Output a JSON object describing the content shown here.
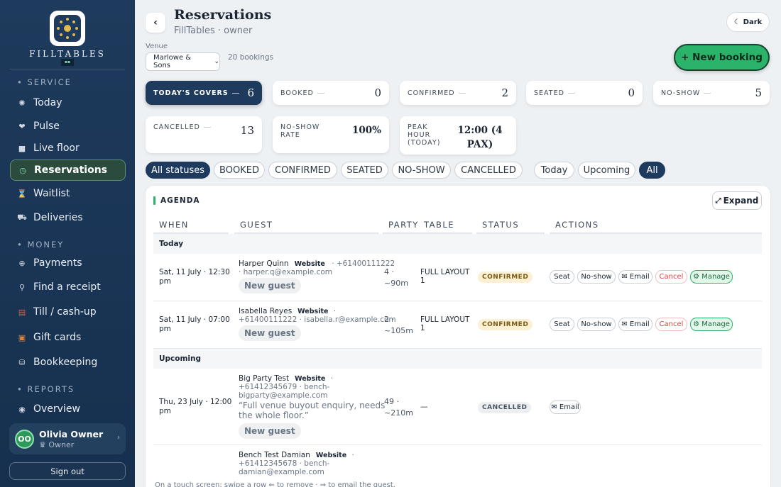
{
  "sidebar": {
    "brand": "FILLTABLES",
    "sections": {
      "service": "SERVICE",
      "money": "MONEY",
      "reports": "REPORTS"
    },
    "items": [
      {
        "label": "Today",
        "icon": "sun-icon"
      },
      {
        "label": "Pulse",
        "icon": "heart-icon"
      },
      {
        "label": "Live floor",
        "icon": "floor-icon"
      },
      {
        "label": "Reservations",
        "icon": "clock-icon"
      },
      {
        "label": "Waitlist",
        "icon": "hourglass-icon"
      },
      {
        "label": "Deliveries",
        "icon": "truck-icon"
      },
      {
        "label": "Payments",
        "icon": "circle-plus-icon"
      },
      {
        "label": "Find a receipt",
        "icon": "search-icon"
      },
      {
        "label": "Till / cash-up",
        "icon": "till-icon"
      },
      {
        "label": "Gift cards",
        "icon": "gift-icon"
      },
      {
        "label": "Bookkeeping",
        "icon": "database-icon"
      },
      {
        "label": "Overview",
        "icon": "radio-icon"
      }
    ],
    "user": {
      "initials": "OO",
      "name": "Olivia Owner",
      "role": "Owner"
    },
    "signout": "Sign out"
  },
  "header": {
    "title": "Reservations",
    "subtitle": "FillTables · owner",
    "dark_label": "Dark",
    "venue_label": "Venue",
    "venue": "Marlowe & Sons",
    "bookings_count": "20 bookings",
    "new_booking": "+ New booking"
  },
  "stats": [
    {
      "label": "TODAY'S COVERS",
      "value": "6"
    },
    {
      "label": "BOOKED",
      "value": "0"
    },
    {
      "label": "CONFIRMED",
      "value": "2"
    },
    {
      "label": "SEATED",
      "value": "0"
    },
    {
      "label": "NO-SHOW",
      "value": "5"
    },
    {
      "label": "CANCELLED",
      "value": "13"
    },
    {
      "label": "NO-SHOW RATE",
      "value": "100%"
    },
    {
      "label": "PEAK HOUR (TODAY)",
      "value": "12:00 (4 PAX)"
    }
  ],
  "filters": {
    "statuses": [
      "All statuses",
      "BOOKED",
      "CONFIRMED",
      "SEATED",
      "NO-SHOW",
      "CANCELLED"
    ],
    "ranges": [
      "Today",
      "Upcoming",
      "All"
    ]
  },
  "agenda": {
    "title": "AGENDA",
    "expand": "Expand",
    "columns": [
      "WHEN",
      "GUEST",
      "PARTY",
      "TABLE",
      "STATUS",
      "ACTIONS"
    ],
    "groups": [
      "Today",
      "Upcoming"
    ],
    "rows": [
      {
        "when": [
          "Sat, 11 July · 12:30",
          "pm"
        ],
        "name": "Harper Quinn",
        "source": "Website",
        "phone": "· +61400111222",
        "email": "· harper.q@example.com",
        "tag": "New guest",
        "party": [
          "4 ·",
          "~90m"
        ],
        "table": [
          "FULL LAYOUT",
          "1"
        ],
        "status": "CONFIRMED"
      },
      {
        "when": [
          "Sat, 11 July · 07:00",
          "pm"
        ],
        "name": "Isabella Reyes",
        "source": "Website",
        "contact": "+61400111222 · isabella.r@example.com",
        "tag": "New guest",
        "party": [
          "2 ·",
          "~105m"
        ],
        "table": [
          "FULL LAYOUT",
          "1"
        ],
        "status": "CONFIRMED"
      },
      {
        "when": [
          "Thu, 23 July · 12:00",
          "pm"
        ],
        "name": "Big Party Test",
        "source": "Website",
        "contact": [
          "+61412345679 · bench-",
          "bigparty@example.com"
        ],
        "note": [
          "“Full venue buyout enquiry, needs",
          "the whole floor.”"
        ],
        "tag": "New guest",
        "party": [
          "49 ·",
          "~210m"
        ],
        "table": "—",
        "status": "CANCELLED"
      },
      {
        "name": "Bench Test Damian",
        "source": "Website",
        "contact": [
          "+61412345678 · bench-",
          "damian@example.com"
        ]
      }
    ],
    "actions": {
      "seat": "Seat",
      "noshow": "No-show",
      "email": "✉ Email",
      "cancel": "Cancel",
      "manage": "⚙ Manage"
    }
  },
  "footnote": "On a touch screen: swipe a row ⇐ to remove · ⇒ to email the guest."
}
